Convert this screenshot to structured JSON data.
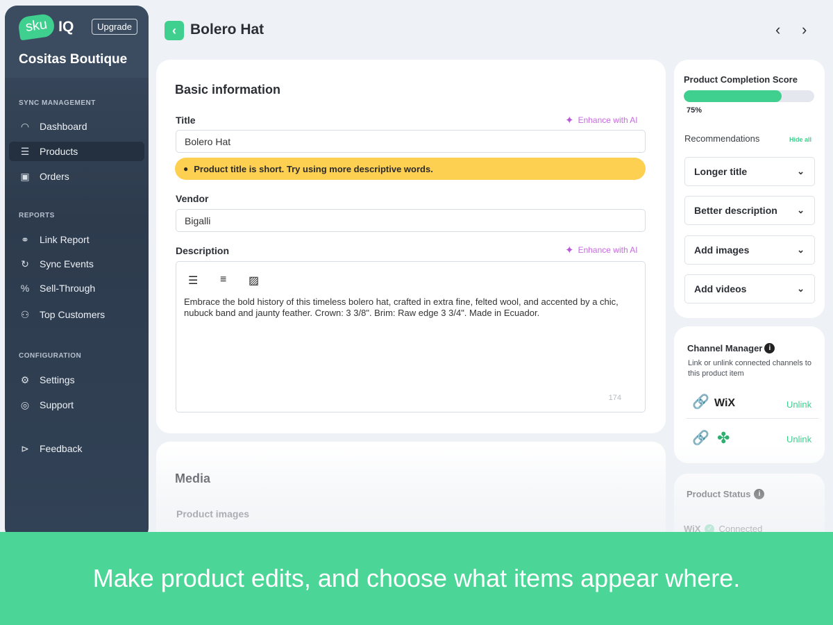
{
  "sidebar": {
    "logo_sku": "sku",
    "logo_iq": "IQ",
    "upgrade_label": "Upgrade",
    "store_name": "Cositas Boutique",
    "sections": [
      {
        "title": "SYNC MANAGEMENT",
        "items": [
          {
            "label": "Dashboard",
            "icon": "gauge-icon"
          },
          {
            "label": "Products",
            "icon": "list-icon"
          },
          {
            "label": "Orders",
            "icon": "receipt-icon"
          }
        ]
      },
      {
        "title": "REPORTS",
        "items": [
          {
            "label": "Link Report",
            "icon": "link-icon"
          },
          {
            "label": "Sync Events",
            "icon": "sync-icon"
          },
          {
            "label": "Sell-Through",
            "icon": "percent-icon"
          },
          {
            "label": "Top Customers",
            "icon": "users-icon"
          }
        ]
      },
      {
        "title": "CONFIGURATION",
        "items": [
          {
            "label": "Settings",
            "icon": "gear-icon"
          },
          {
            "label": "Support",
            "icon": "lifebuoy-icon"
          }
        ]
      }
    ],
    "feedback_label": "Feedback"
  },
  "header": {
    "title": "Bolero Hat"
  },
  "basic": {
    "heading": "Basic information",
    "title_label": "Title",
    "enhance_label": "Enhance with AI",
    "title_value": "Bolero Hat",
    "alert": "Product title is short. Try using more descriptive words.",
    "vendor_label": "Vendor",
    "vendor_value": "Bigalli",
    "description_label": "Description",
    "description_value": "Embrace the bold history of this timeless bolero hat, crafted in extra fine, felted wool, and accented by a chic, nubuck band and jaunty feather. Crown: 3 3/8\". Brim: Raw edge 3 3/4\". Made in Ecuador.",
    "char_count": "174"
  },
  "media": {
    "heading": "Media",
    "images_label": "Product images"
  },
  "completion": {
    "title": "Product Completion Score",
    "percent_label": "75%",
    "progress": 0.75,
    "recommendations_label": "Recommendations",
    "hide_all": "Hide all",
    "items": [
      "Longer title",
      "Better description",
      "Add images",
      "Add videos"
    ]
  },
  "channels": {
    "title": "Channel Manager",
    "subtitle": "Link or unlink connected channels to this product item",
    "rows": [
      {
        "name": "WiX",
        "action": "Unlink"
      },
      {
        "name": "",
        "action": "Unlink"
      }
    ]
  },
  "status": {
    "title": "Product Status",
    "channel": "WiX",
    "state": "Connected"
  },
  "banner": {
    "text": "Make product edits, and choose what items appear where."
  },
  "colors": {
    "accent": "#3fcf8e",
    "alert": "#fdd052",
    "sidebar": "#2d3b4d"
  }
}
